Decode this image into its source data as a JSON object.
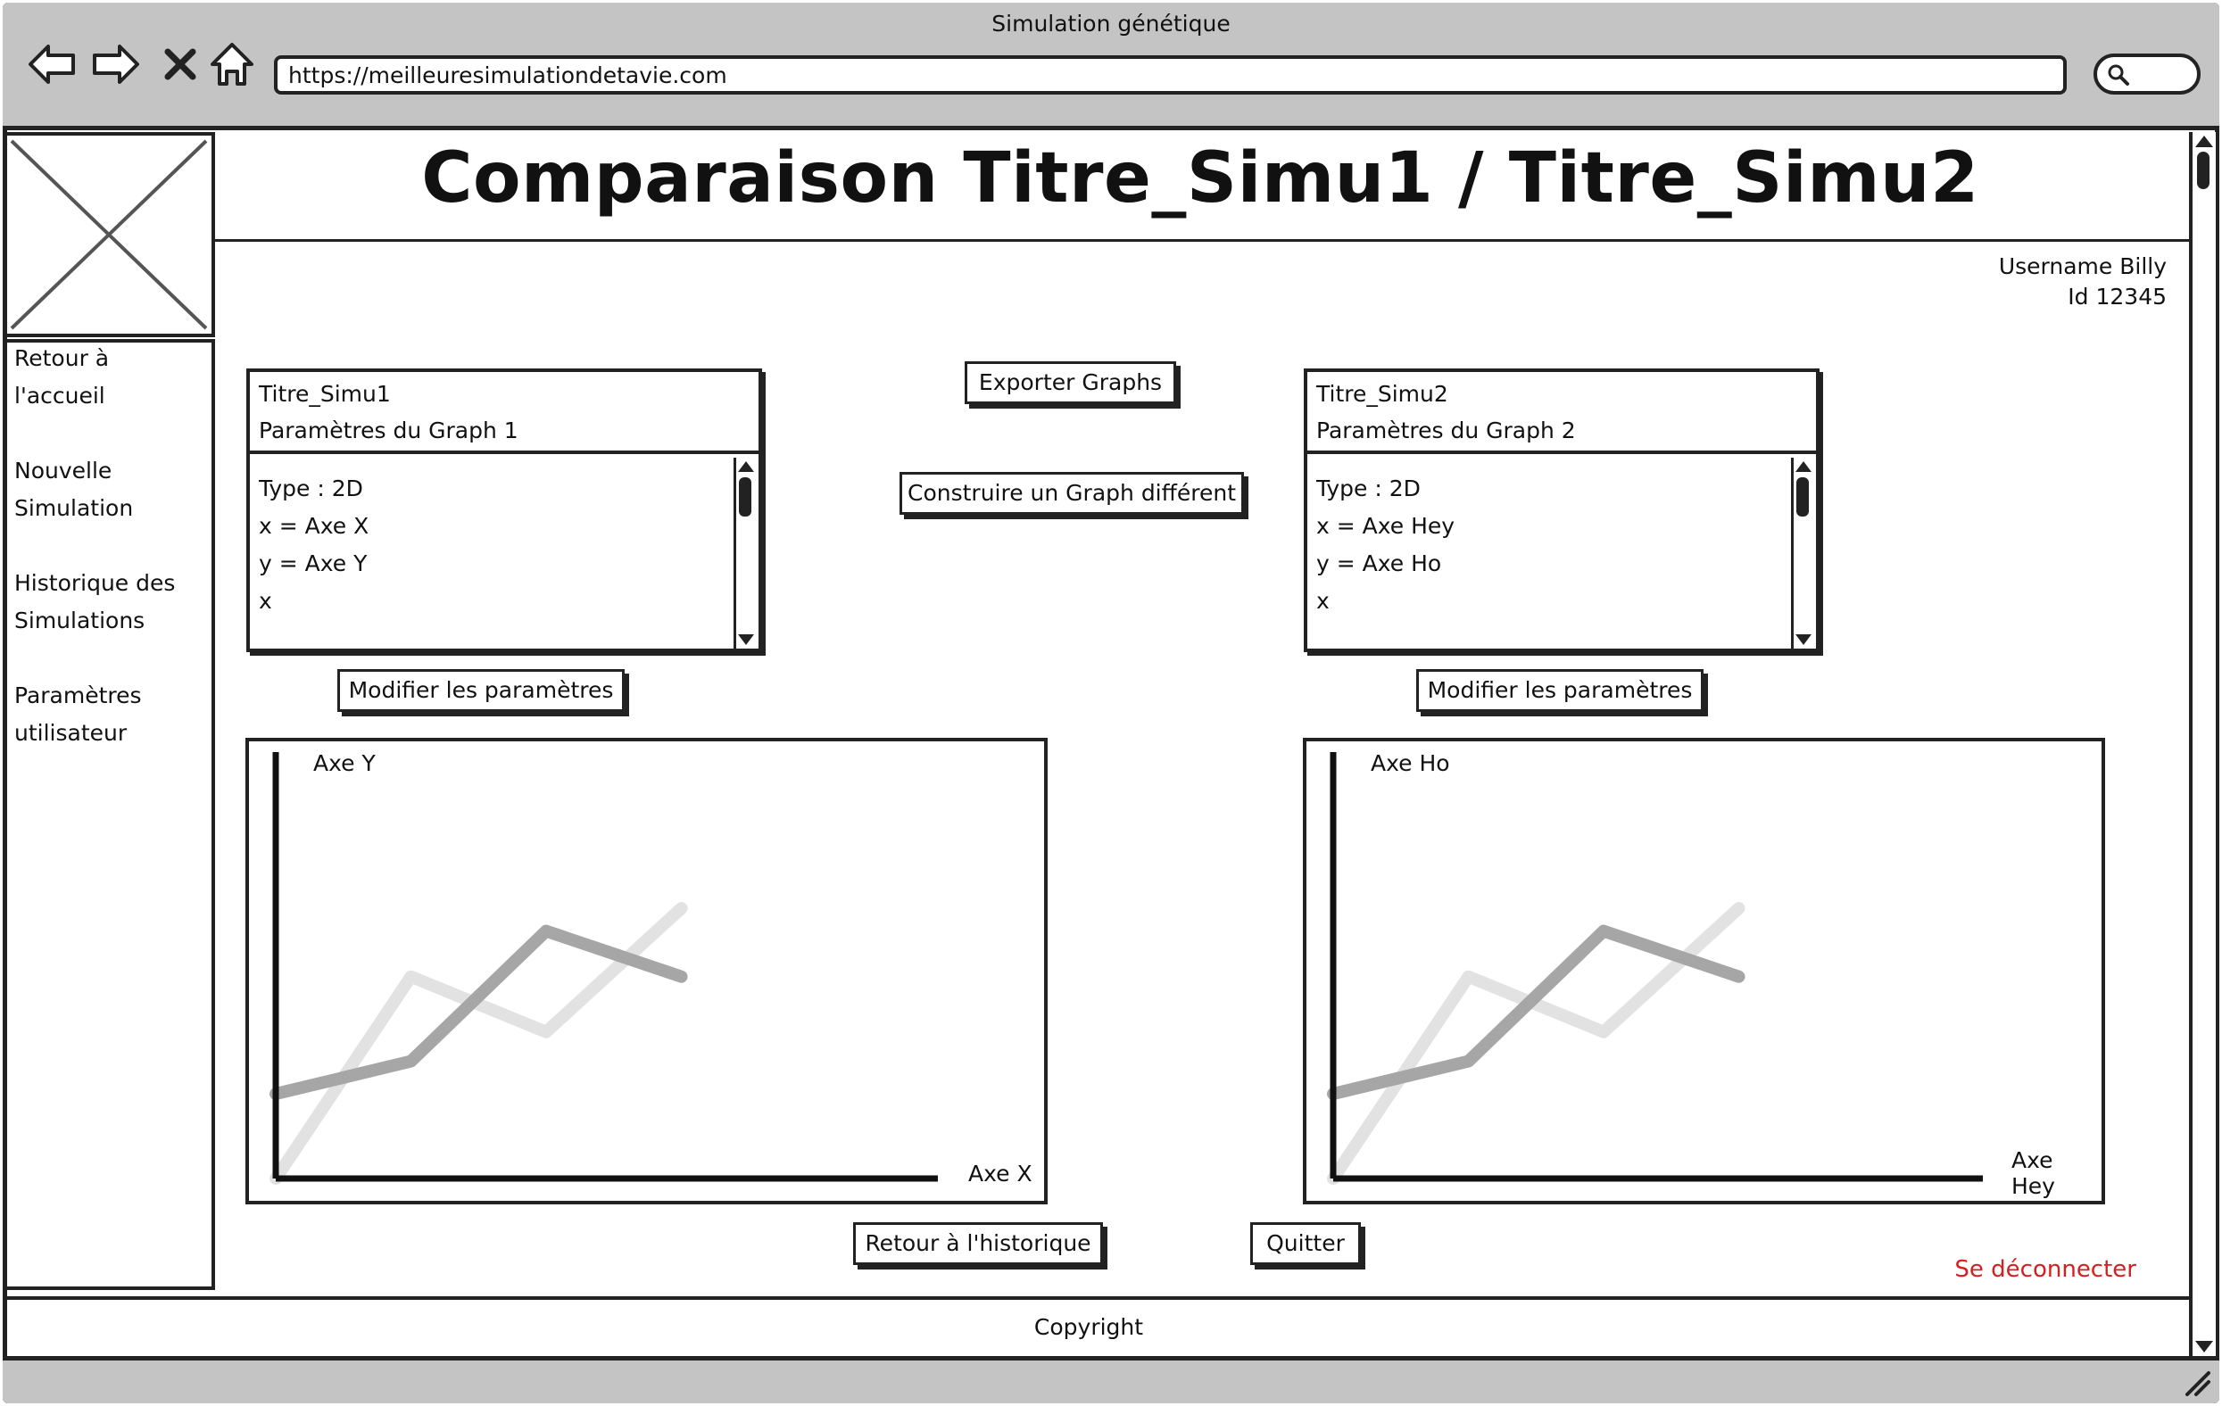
{
  "browser": {
    "window_title": "Simulation génétique",
    "url": "https://meilleuresimulationdetavie.com"
  },
  "sidebar": {
    "items": [
      {
        "label": "Retour à\nl'accueil"
      },
      {
        "label": "Nouvelle\nSimulation"
      },
      {
        "label": "Historique des\nSimulations"
      },
      {
        "label": "Paramètres\nutilisateur"
      }
    ]
  },
  "header": {
    "title": "Comparaison Titre_Simu1 / Titre_Simu2",
    "username": "Username Billy",
    "user_id": "Id 12345"
  },
  "panels": [
    {
      "title": "Titre_Simu1",
      "subtitle": "Paramètres du Graph 1",
      "lines": [
        "Type : 2D",
        "x = Axe X",
        "y = Axe Y",
        "x"
      ]
    },
    {
      "title": "Titre_Simu2",
      "subtitle": "Paramètres du Graph 2",
      "lines": [
        "Type : 2D",
        "x = Axe Hey",
        "y = Axe Ho",
        "x"
      ]
    }
  ],
  "buttons": {
    "export": "Exporter Graphs",
    "build": "Construire un Graph différent",
    "modify_1": "Modifier les paramètres",
    "modify_2": "Modifier les paramètres",
    "back_history": "Retour à l'historique",
    "quit": "Quitter",
    "logout": "Se déconnecter"
  },
  "footer": {
    "copyright": "Copyright"
  },
  "chart_data": [
    {
      "type": "line",
      "xlabel": "Axe X",
      "ylabel": "Axe Y",
      "x": [
        0,
        1,
        2,
        3
      ],
      "xlim": [
        0,
        3.3
      ],
      "ylim": [
        0,
        10
      ],
      "series": [
        {
          "values": [
            0,
            6.2,
            4.5,
            8.3
          ],
          "color": "#e2e2e2"
        },
        {
          "values": [
            2.6,
            3.6,
            7.6,
            6.2
          ],
          "color": "#a6a6a6"
        }
      ]
    },
    {
      "type": "line",
      "xlabel": "Axe Hey",
      "ylabel": "Axe Ho",
      "x": [
        0,
        1,
        2,
        3
      ],
      "xlim": [
        0,
        3.3
      ],
      "ylim": [
        0,
        10
      ],
      "series": [
        {
          "values": [
            0,
            6.2,
            4.5,
            8.3
          ],
          "color": "#e2e2e2"
        },
        {
          "values": [
            2.6,
            3.6,
            7.6,
            6.2
          ],
          "color": "#a6a6a6"
        }
      ]
    }
  ]
}
